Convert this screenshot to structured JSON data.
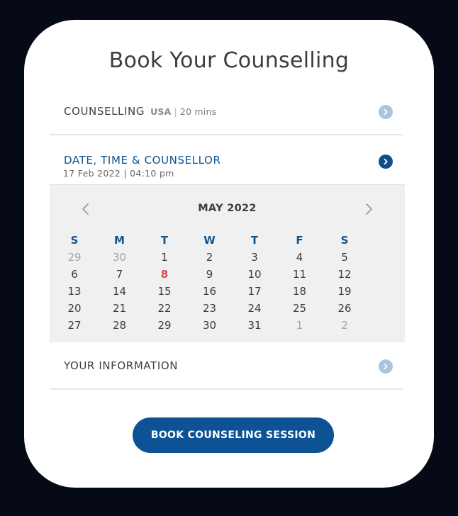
{
  "page": {
    "title": "Book Your Counselling"
  },
  "counselling": {
    "label": "COUNSELLING",
    "region": "USA",
    "separator": "|",
    "duration": "20 mins"
  },
  "date_time": {
    "label": "DATE, TIME & COUNSELLOR",
    "selected": "17 Feb 2022 | 04:10 pm"
  },
  "calendar": {
    "month_label": "MAY 2022",
    "weekdays": [
      "S",
      "M",
      "T",
      "W",
      "T",
      "F",
      "S"
    ],
    "days": [
      {
        "label": "29",
        "state": "muted"
      },
      {
        "label": "30",
        "state": "muted"
      },
      {
        "label": "1",
        "state": "normal"
      },
      {
        "label": "2",
        "state": "normal"
      },
      {
        "label": "3",
        "state": "normal"
      },
      {
        "label": "4",
        "state": "normal"
      },
      {
        "label": "5",
        "state": "normal"
      },
      {
        "label": "6",
        "state": "normal"
      },
      {
        "label": "7",
        "state": "normal"
      },
      {
        "label": "8",
        "state": "today"
      },
      {
        "label": "9",
        "state": "normal"
      },
      {
        "label": "10",
        "state": "normal"
      },
      {
        "label": "11",
        "state": "normal"
      },
      {
        "label": "12",
        "state": "normal"
      },
      {
        "label": "13",
        "state": "normal"
      },
      {
        "label": "14",
        "state": "normal"
      },
      {
        "label": "15",
        "state": "normal"
      },
      {
        "label": "16",
        "state": "normal"
      },
      {
        "label": "17",
        "state": "normal"
      },
      {
        "label": "18",
        "state": "normal"
      },
      {
        "label": "19",
        "state": "normal"
      },
      {
        "label": "20",
        "state": "normal"
      },
      {
        "label": "21",
        "state": "normal"
      },
      {
        "label": "22",
        "state": "normal"
      },
      {
        "label": "23",
        "state": "normal"
      },
      {
        "label": "24",
        "state": "normal"
      },
      {
        "label": "25",
        "state": "normal"
      },
      {
        "label": "26",
        "state": "normal"
      },
      {
        "label": "27",
        "state": "normal"
      },
      {
        "label": "28",
        "state": "normal"
      },
      {
        "label": "29",
        "state": "normal"
      },
      {
        "label": "30",
        "state": "normal"
      },
      {
        "label": "31",
        "state": "normal"
      },
      {
        "label": "1",
        "state": "muted"
      },
      {
        "label": "2",
        "state": "muted"
      }
    ]
  },
  "your_information": {
    "label": "YOUR INFORMATION"
  },
  "book_button": {
    "label": "BOOK COUNSELING SESSION"
  },
  "icons": {
    "counselling_chevron": "chevron-right-icon",
    "date_chevron": "chevron-right-icon",
    "info_chevron": "chevron-right-icon",
    "prev_month": "chevron-left-icon",
    "next_month": "chevron-right-icon"
  },
  "colors": {
    "background": "#050a16",
    "card": "#ffffff",
    "accent": "#0d5294",
    "chevron_inactive": "#a9c5df",
    "today": "#e24a4a",
    "calendar_bg": "#f0f0f0"
  }
}
